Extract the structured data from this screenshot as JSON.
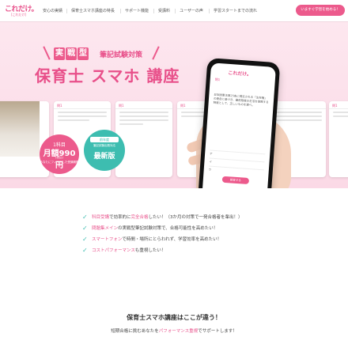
{
  "header": {
    "logo_main": "これだけ。",
    "logo_sub": "[これだけ]",
    "nav": [
      "安心の実績",
      "保育士スマホ講座の特長",
      "サポート機能",
      "受講料",
      "ユーザーの声",
      "学習スタートまでの流れ"
    ],
    "cta": "いますぐ学習を始める！"
  },
  "hero": {
    "tag_chars": [
      "実",
      "戦",
      "型"
    ],
    "tag_rest": "筆記試験対策",
    "title": "保育士 スマホ 講座",
    "price_badge": {
      "l1": "1科目",
      "l2": "月額990円",
      "l3": "(税込)",
      "l4": "あなたにフィットした受講期間を"
    },
    "new_badge": {
      "l1": "前年度",
      "l2": "筆記試験出題対応",
      "l3": "最新版"
    },
    "cards": [
      {
        "head": "問1"
      },
      {
        "head": "問1"
      },
      {
        "head": "問1"
      },
      {
        "head": "問1"
      },
      {
        "head": "問1"
      },
      {
        "head": "問1"
      }
    ],
    "phone": {
      "logo": "これだけ。",
      "question": "問1",
      "text": "日本国憲法第25条に規定される「生存権」の理念に基づき、最低限度の生活を保障する制度として、正しいものを選べ。",
      "options": [
        "ア",
        "イ",
        "ウ"
      ],
      "button": "解答する"
    }
  },
  "checklist": [
    {
      "hl": "科目受講",
      "mid": "で効率的に",
      "hl2": "完全合格",
      "rest": "したい！（3か月の対策で一発合格者を輩出！）"
    },
    {
      "hl": "問題集メイン",
      "mid": "の実戦型筆記試験対策で、合格可能性を高めたい！",
      "hl2": "",
      "rest": ""
    },
    {
      "hl": "スマートフォン",
      "mid": "で時間・場所にとらわれず、学習効率を高めたい！",
      "hl2": "",
      "rest": ""
    },
    {
      "hl": "コストパフォーマンス",
      "mid": "も重視したい！",
      "hl2": "",
      "rest": ""
    }
  ],
  "section": {
    "title": "保育士スマホ講座はここが違う！",
    "subtitle_pre": "短期合格に挑むあなたを",
    "subtitle_hl": "パフォーマンス重視",
    "subtitle_post": "でサポートします！"
  },
  "colors": {
    "accent": "#ec5a8c",
    "teal": "#3dbdb0",
    "hero_bg": "#fde7ef"
  },
  "icons": {
    "check": "check-icon"
  }
}
